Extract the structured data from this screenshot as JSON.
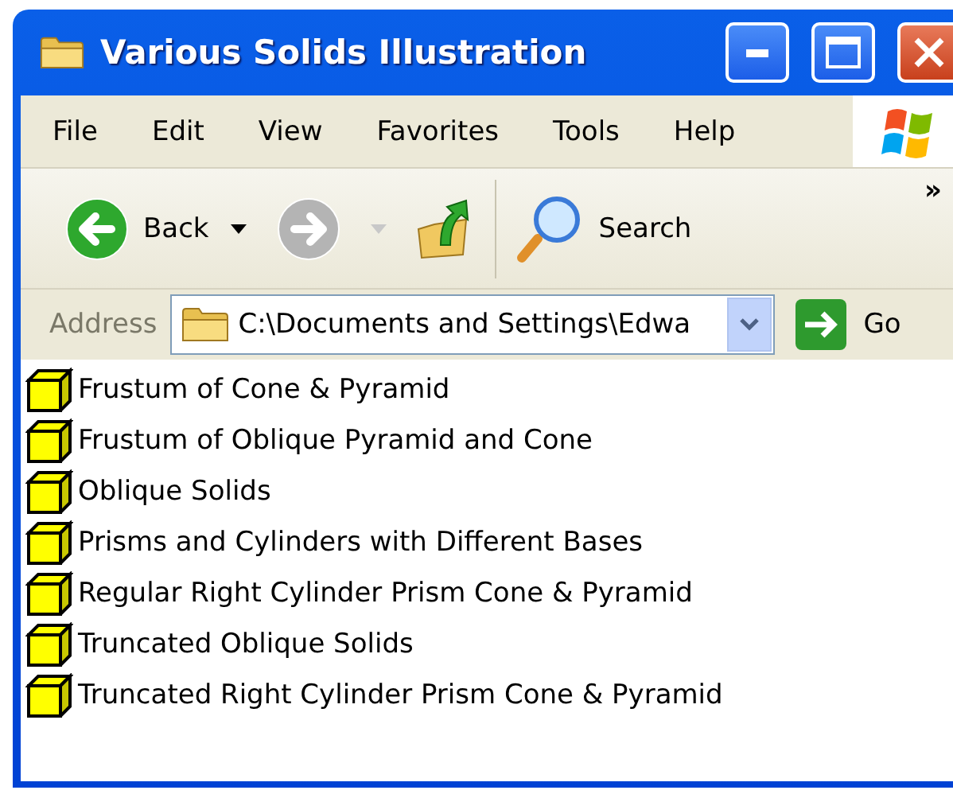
{
  "window": {
    "title": "Various Solids Illustration"
  },
  "menu": [
    "File",
    "Edit",
    "View",
    "Favorites",
    "Tools",
    "Help"
  ],
  "toolbar": {
    "back": "Back",
    "search": "Search",
    "more": "»",
    "forward_disabled": true
  },
  "address": {
    "label": "Address",
    "value": "C:\\Documents and Settings\\Edwa",
    "go": "Go"
  },
  "items": [
    {
      "name": "Frustum of Cone & Pyramid"
    },
    {
      "name": "Frustum of Oblique Pyramid and Cone"
    },
    {
      "name": "Oblique Solids"
    },
    {
      "name": "Prisms and Cylinders with Different Bases"
    },
    {
      "name": "Regular Right Cylinder Prism Cone & Pyramid"
    },
    {
      "name": "Truncated Oblique Solids"
    },
    {
      "name": "Truncated Right Cylinder Prism Cone & Pyramid"
    }
  ]
}
